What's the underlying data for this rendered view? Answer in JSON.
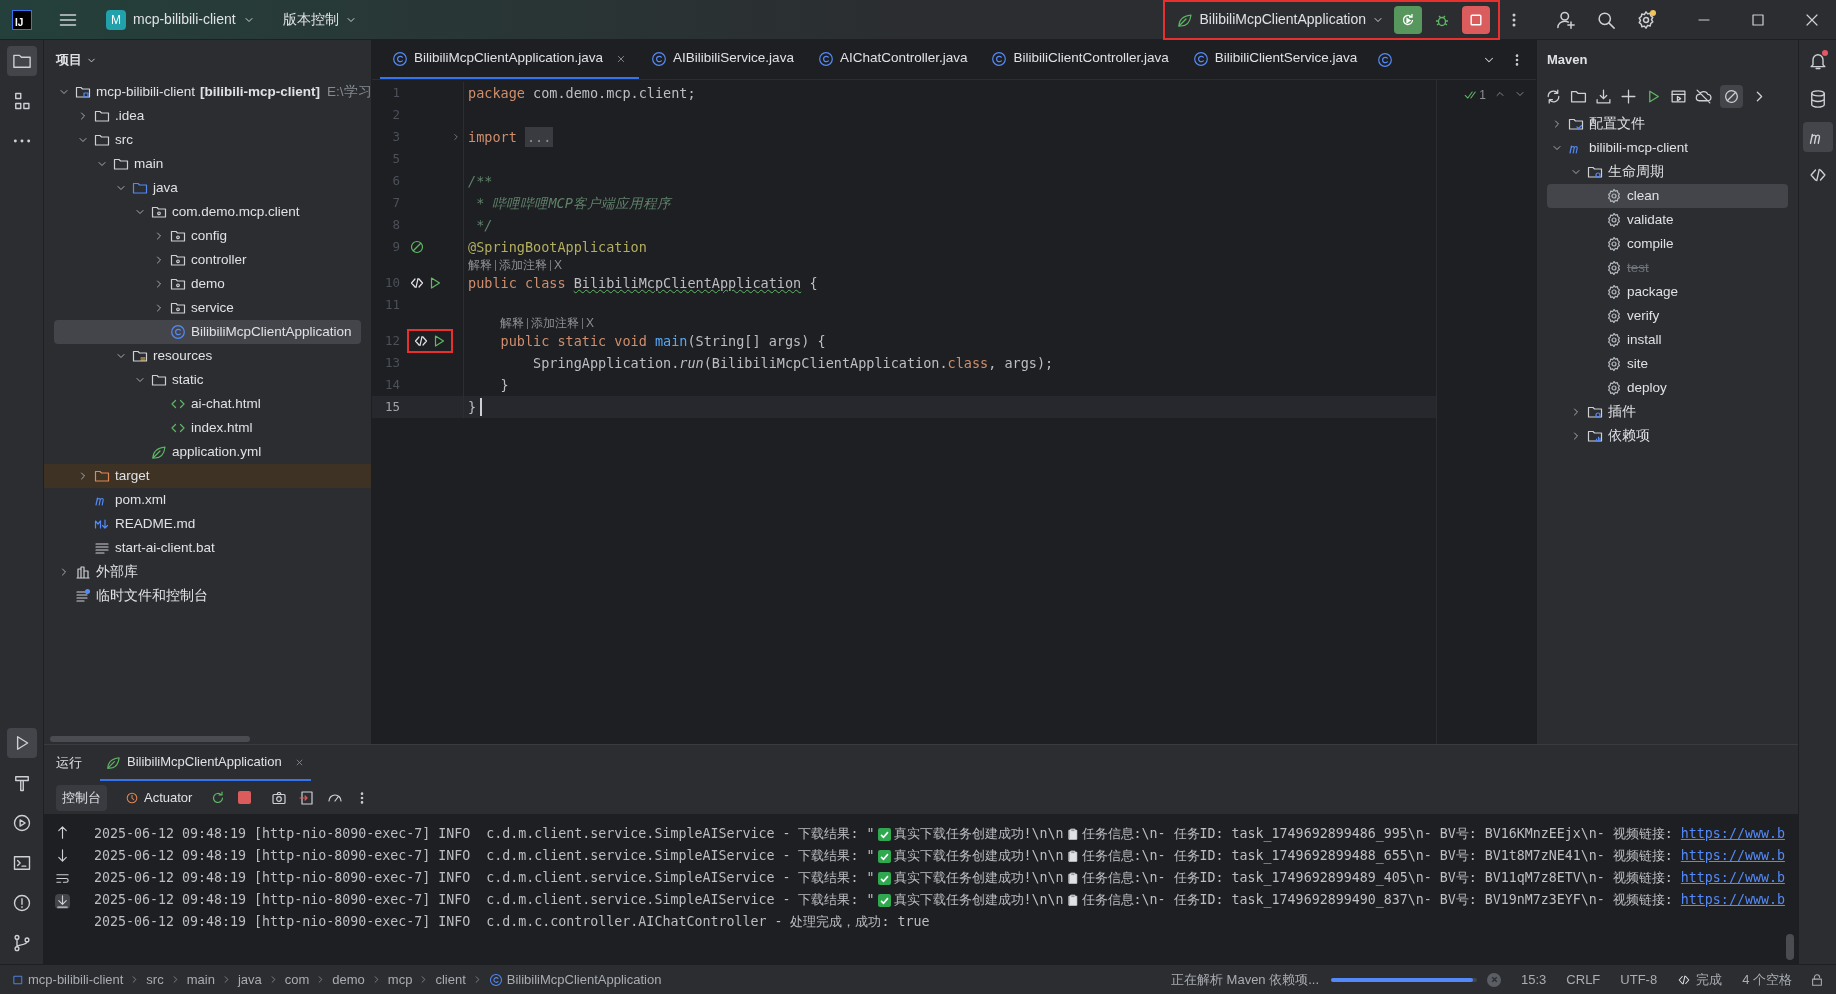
{
  "title_bar": {
    "logo": "IJ",
    "project_badge": "M",
    "project": "mcp-bilibili-client",
    "vcs": "版本控制",
    "run_config": "BilibiliMcpClientApplication"
  },
  "project_panel": {
    "title": "项目",
    "tree": [
      {
        "label": "mcp-bilibili-client",
        "bold": "[bilibili-mcp-client]",
        "path": "E:\\学习",
        "kind": "module",
        "expanded": true,
        "selected": false,
        "children": [
          {
            "label": ".idea",
            "kind": "folder",
            "expanded": false,
            "selected": false
          },
          {
            "label": "src",
            "kind": "folder",
            "expanded": true,
            "selected": false,
            "children": [
              {
                "label": "main",
                "kind": "folder",
                "expanded": true,
                "selected": false,
                "children": [
                  {
                    "label": "java",
                    "kind": "source",
                    "expanded": true,
                    "selected": false,
                    "children": [
                      {
                        "label": "com.demo.mcp.client",
                        "kind": "package",
                        "expanded": true,
                        "selected": false,
                        "children": [
                          {
                            "label": "config",
                            "kind": "package",
                            "expanded": false,
                            "selected": false
                          },
                          {
                            "label": "controller",
                            "kind": "package",
                            "expanded": false,
                            "selected": false
                          },
                          {
                            "label": "demo",
                            "kind": "package",
                            "expanded": false,
                            "selected": false
                          },
                          {
                            "label": "service",
                            "kind": "package",
                            "expanded": false,
                            "selected": false
                          },
                          {
                            "label": "BilibiliMcpClientApplication",
                            "kind": "class",
                            "selected": true
                          }
                        ]
                      }
                    ]
                  },
                  {
                    "label": "resources",
                    "kind": "resources",
                    "expanded": true,
                    "selected": false,
                    "children": [
                      {
                        "label": "static",
                        "kind": "folder",
                        "expanded": true,
                        "selected": false,
                        "children": [
                          {
                            "label": "ai-chat.html",
                            "kind": "html",
                            "selected": false
                          },
                          {
                            "label": "index.html",
                            "kind": "html",
                            "selected": false
                          }
                        ]
                      },
                      {
                        "label": "application.yml",
                        "kind": "yml",
                        "selected": false
                      }
                    ]
                  }
                ]
              }
            ]
          },
          {
            "label": "target",
            "kind": "excluded",
            "expanded": false,
            "selected": false
          },
          {
            "label": "pom.xml",
            "kind": "pom",
            "selected": false
          },
          {
            "label": "README.md",
            "kind": "md",
            "selected": false
          },
          {
            "label": "start-ai-client.bat",
            "kind": "text",
            "selected": false
          }
        ]
      },
      {
        "label": "外部库",
        "kind": "library",
        "expanded": false,
        "selected": false
      },
      {
        "label": "临时文件和控制台",
        "kind": "scratch",
        "selected": false
      }
    ]
  },
  "editor": {
    "tabs": [
      {
        "label": "BilibiliMcpClientApplication.java",
        "selected": true
      },
      {
        "label": "AIBilibiliService.java",
        "selected": false
      },
      {
        "label": "AIChatController.java",
        "selected": false
      },
      {
        "label": "BilibiliClientController.java",
        "selected": false
      },
      {
        "label": "BilibiliClientService.java",
        "selected": false
      }
    ],
    "inspection_count": "1",
    "lines": [
      {
        "kind": "code",
        "number": "1",
        "tokens": [
          {
            "t": "package",
            "kind": "keyword"
          },
          {
            "t": " com.demo.mcp.client;",
            "kind": "plain"
          }
        ]
      },
      {
        "kind": "code",
        "number": "2"
      },
      {
        "kind": "code",
        "number": "3",
        "fold": true,
        "tokens": [
          {
            "t": "import ",
            "kind": "keyword"
          },
          {
            "t": "...",
            "kind": "folded"
          }
        ]
      },
      {
        "kind": "code",
        "number": "5"
      },
      {
        "kind": "code",
        "number": "6",
        "tokens": [
          {
            "t": "/**",
            "kind": "doc"
          }
        ]
      },
      {
        "kind": "code",
        "number": "7",
        "tokens": [
          {
            "t": " * 哔哩哔哩MCP客户端应用程序",
            "kind": "doc"
          }
        ]
      },
      {
        "kind": "code",
        "number": "8",
        "tokens": [
          {
            "t": " */",
            "kind": "doc"
          }
        ]
      },
      {
        "kind": "code",
        "number": "9",
        "gutter": {
          "kind": "bean"
        },
        "tokens": [
          {
            "t": "@SpringBootApplication",
            "kind": "annotation"
          }
        ]
      },
      {
        "kind": "hint",
        "indented": false,
        "parts": [
          "解释",
          "添加注释",
          "X"
        ]
      },
      {
        "kind": "code",
        "number": "10",
        "gutter": {
          "kind": "run"
        },
        "tokens": [
          {
            "t": "public class ",
            "kind": "keyword"
          },
          {
            "t": "BilibiliMcpClientApplication",
            "kind": "warn"
          },
          {
            "t": " {",
            "kind": "plain"
          }
        ]
      },
      {
        "kind": "code",
        "number": "11"
      },
      {
        "kind": "hint",
        "indented": true,
        "parts": [
          "解释",
          "添加注释",
          "X"
        ]
      },
      {
        "kind": "code",
        "number": "12",
        "gutter": {
          "kind": "run"
        },
        "highlighted": true,
        "tokens": [
          {
            "t": "    public static void ",
            "kind": "keyword"
          },
          {
            "t": "main",
            "kind": "method"
          },
          {
            "t": "(String[] args) {",
            "kind": "plain"
          }
        ]
      },
      {
        "kind": "code",
        "number": "13",
        "tokens": [
          {
            "t": "        SpringApplication.",
            "kind": "plain"
          },
          {
            "t": "run",
            "kind": "static"
          },
          {
            "t": "(BilibiliMcpClientApplication.",
            "kind": "plain"
          },
          {
            "t": "class",
            "kind": "keyword"
          },
          {
            "t": ", args);",
            "kind": "plain"
          }
        ]
      },
      {
        "kind": "code",
        "number": "14",
        "tokens": [
          {
            "t": "    }",
            "kind": "plain"
          }
        ]
      },
      {
        "kind": "code",
        "number": "15",
        "current": true,
        "tokens": [
          {
            "t": "}",
            "kind": "plain"
          }
        ]
      }
    ]
  },
  "maven_panel": {
    "title": "Maven",
    "tree": [
      {
        "label": "配置文件",
        "kind": "profiles",
        "expanded": false,
        "selected": false
      },
      {
        "label": "bilibili-mcp-client",
        "kind": "project",
        "expanded": true,
        "selected": false,
        "children": [
          {
            "label": "生命周期",
            "kind": "lifecycle",
            "expanded": true,
            "selected": false,
            "children": [
              {
                "label": "clean",
                "kind": "goal",
                "selected": true,
                "disabled": false
              },
              {
                "label": "validate",
                "kind": "goal",
                "selected": false,
                "disabled": false
              },
              {
                "label": "compile",
                "kind": "goal",
                "selected": false,
                "disabled": false
              },
              {
                "label": "test",
                "kind": "goal",
                "selected": false,
                "disabled": true
              },
              {
                "label": "package",
                "kind": "goal",
                "selected": false,
                "disabled": false
              },
              {
                "label": "verify",
                "kind": "goal",
                "selected": false,
                "disabled": false
              },
              {
                "label": "install",
                "kind": "goal",
                "selected": false,
                "disabled": false
              },
              {
                "label": "site",
                "kind": "goal",
                "selected": false,
                "disabled": false
              },
              {
                "label": "deploy",
                "kind": "goal",
                "selected": false,
                "disabled": false
              }
            ]
          },
          {
            "label": "插件",
            "kind": "plugins",
            "expanded": false,
            "selected": false
          },
          {
            "label": "依赖项",
            "kind": "dependencies",
            "expanded": false,
            "selected": false
          }
        ]
      }
    ]
  },
  "run_panel": {
    "title": "运行",
    "tab": "BilibiliMcpClientApplication",
    "subtabs": [
      {
        "label": "控制台",
        "selected": true
      },
      {
        "label": "Actuator",
        "selected": false
      }
    ],
    "console": [
      {
        "kind": "download",
        "before": "2025-06-12 09:48:19 [http-nio-8090-exec-7] INFO  c.d.m.client.service.SimpleAIService - 下载结果: \"",
        "middle": "真实下载任务创建成功!\\n\\n",
        "after": "任务信息:\\n- 任务ID: task_1749692899486_995\\n- BV号: BV16KMnzEEjx\\n- 视频链接: ",
        "link": "https://www.b"
      },
      {
        "kind": "download",
        "before": "2025-06-12 09:48:19 [http-nio-8090-exec-7] INFO  c.d.m.client.service.SimpleAIService - 下载结果: \"",
        "middle": "真实下载任务创建成功!\\n\\n",
        "after": "任务信息:\\n- 任务ID: task_1749692899488_655\\n- BV号: BV1t8M7zNE41\\n- 视频链接: ",
        "link": "https://www.b"
      },
      {
        "kind": "download",
        "before": "2025-06-12 09:48:19 [http-nio-8090-exec-7] INFO  c.d.m.client.service.SimpleAIService - 下载结果: \"",
        "middle": "真实下载任务创建成功!\\n\\n",
        "after": "任务信息:\\n- 任务ID: task_1749692899489_405\\n- BV号: BV11qM7z8ETV\\n- 视频链接: ",
        "link": "https://www.b"
      },
      {
        "kind": "download",
        "before": "2025-06-12 09:48:19 [http-nio-8090-exec-7] INFO  c.d.m.client.service.SimpleAIService - 下载结果: \"",
        "middle": "真实下载任务创建成功!\\n\\n",
        "after": "任务信息:\\n- 任务ID: task_1749692899490_837\\n- BV号: BV19nM7z3EYF\\n- 视频链接: ",
        "link": "https://www.b"
      },
      {
        "kind": "plain",
        "before": "2025-06-12 09:48:19 [http-nio-8090-exec-7] INFO  c.d.m.c.controller.AIChatController - 处理完成，成功: true"
      }
    ]
  },
  "status_bar": {
    "breadcrumbs": [
      "mcp-bilibili-client",
      "src",
      "main",
      "java",
      "com",
      "demo",
      "mcp",
      "client",
      "BilibiliMcpClientApplication"
    ],
    "task": "正在解析 Maven 依赖项...",
    "task_progress": {
      "level": 0.97
    },
    "position": "15:3",
    "line_separator": "CRLF",
    "encoding": "UTF-8",
    "ai_status": "完成",
    "indent": "4 个空格"
  }
}
